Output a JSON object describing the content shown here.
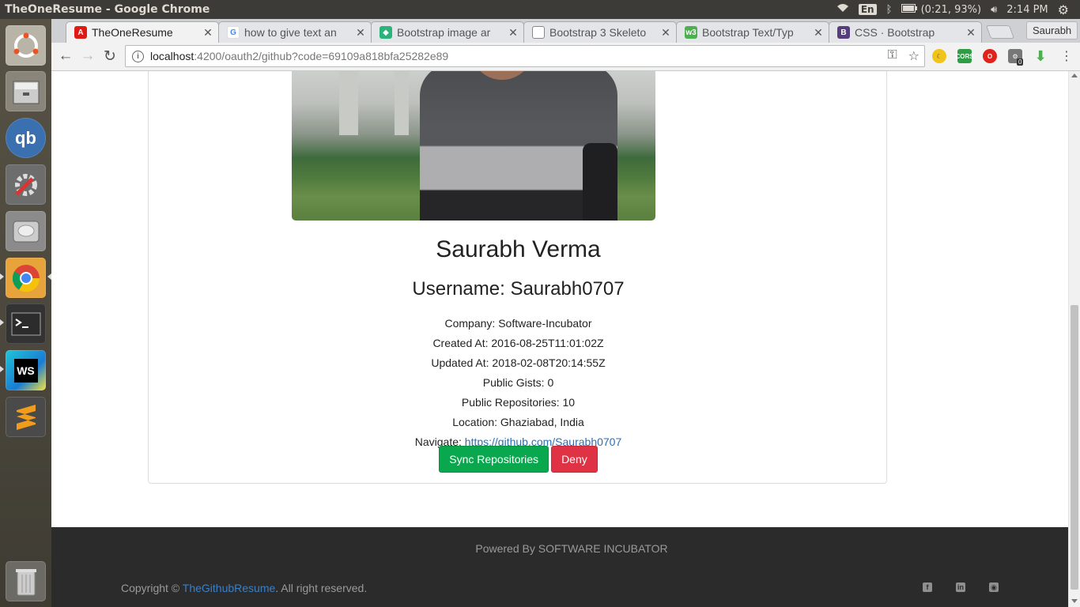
{
  "panel": {
    "window_title": "TheOneResume - Google Chrome",
    "lang": "En",
    "battery": "(0:21, 93%)",
    "time": "2:14 PM"
  },
  "launcher": {
    "items": [
      "ubuntu-dash",
      "files",
      "qbittorrent",
      "system-settings",
      "disks",
      "chrome",
      "terminal",
      "webstorm",
      "sublime-text",
      "trash"
    ]
  },
  "browser": {
    "tabs": [
      {
        "title": "TheOneResume",
        "icon": "angular-icon",
        "active": true
      },
      {
        "title": "how to give text an",
        "icon": "google-icon",
        "active": false
      },
      {
        "title": "Bootstrap image ar",
        "icon": "codepen-icon",
        "active": false
      },
      {
        "title": "Bootstrap 3 Skeleto",
        "icon": "page-icon",
        "active": false
      },
      {
        "title": "Bootstrap Text/Typ",
        "icon": "w3schools-icon",
        "active": false
      },
      {
        "title": "CSS · Bootstrap",
        "icon": "bootstrap-icon",
        "active": false
      }
    ],
    "profile": "Saurabh",
    "url_host": "localhost",
    "url_rest": ":4200/oauth2/github?code=69109a818bfa25282e89",
    "ext_badge": "0",
    "ext_cors": "CORS"
  },
  "profile_card": {
    "name": "Saurabh Verma",
    "username": "Username: Saurabh0707",
    "company": "Company: Software-Incubator",
    "created": "Created At: 2016-08-25T11:01:02Z",
    "updated": "Updated At: 2018-02-08T20:14:55Z",
    "gists": "Public Gists: 0",
    "repos": "Public Repositories: 10",
    "location": "Location: Ghaziabad, India",
    "navigate_label": "Navigate: ",
    "navigate_link": "https://github.com/Saurabh0707",
    "sync_button": "Sync Repositories",
    "deny_button": "Deny"
  },
  "footer": {
    "powered": "Powered By SOFTWARE INCUBATOR",
    "copyright_prefix": "Copyright © ",
    "copyright_link": "TheGithubResume",
    "copyright_suffix": ".  All right reserved."
  },
  "colors": {
    "success": "#0aa84e",
    "danger": "#e03245",
    "link": "#2b6fb6",
    "footer_bg": "#2b2b2b"
  }
}
